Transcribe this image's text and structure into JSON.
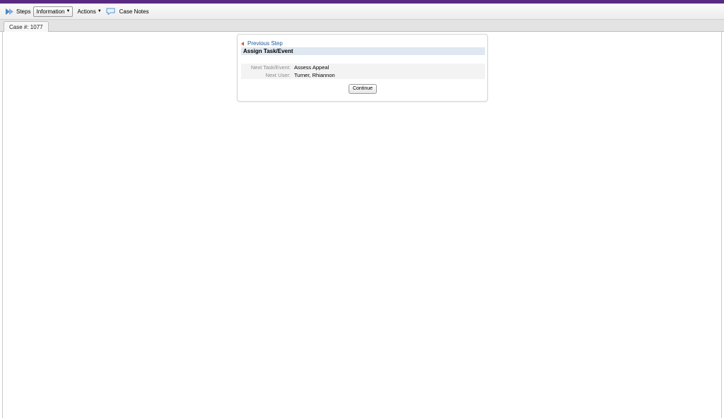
{
  "toolbar": {
    "steps_label": "Steps",
    "information_label": "Information",
    "actions_label": "Actions",
    "case_notes_label": "Case Notes"
  },
  "tabs": [
    {
      "label": "Case #: 1077"
    }
  ],
  "panel": {
    "previous_step_label": "Previous Step",
    "section_title": "Assign Task/Event",
    "fields": [
      {
        "label": "Next Task/Event:",
        "value": "Assess Appeal"
      },
      {
        "label": "Next User:",
        "value": "Turner, Rhiannon"
      }
    ],
    "continue_label": "Continue"
  },
  "colors": {
    "top_accent": "#5a2a82",
    "link": "#1a5a9a",
    "prev_arrow": "#e05a2a",
    "section_bg": "#dfe7f0"
  }
}
